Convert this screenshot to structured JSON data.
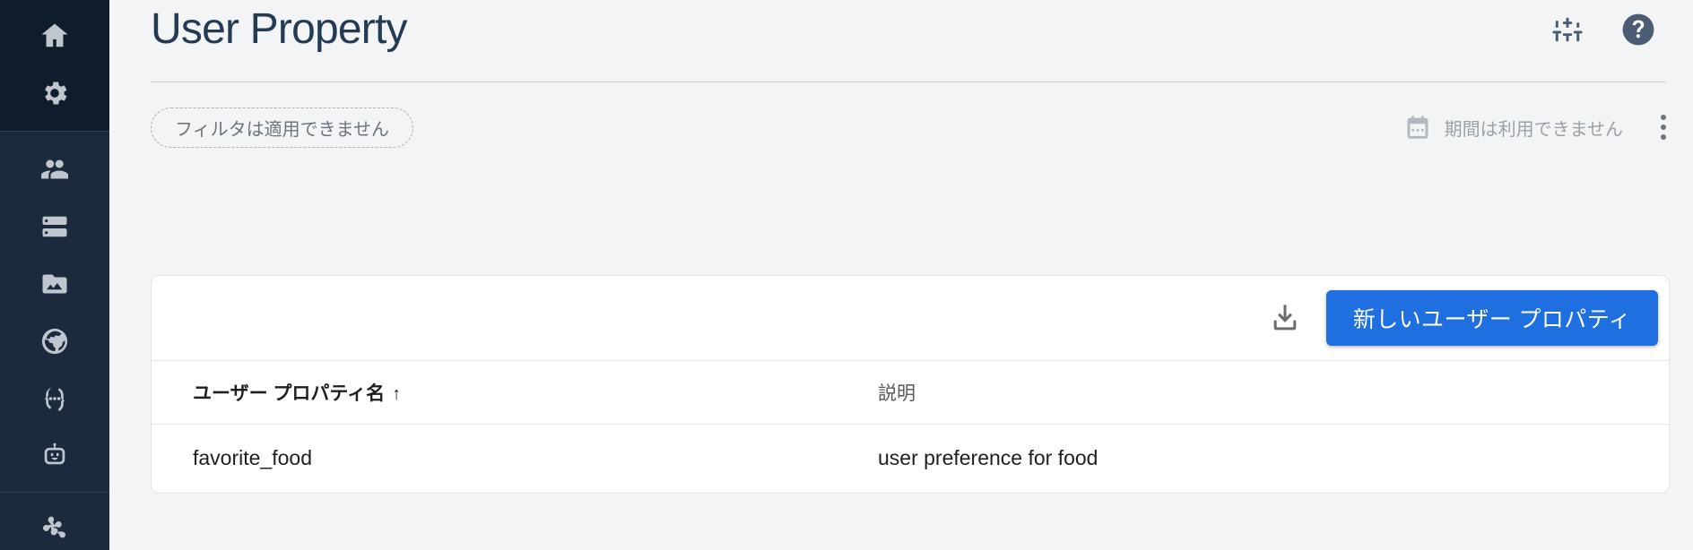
{
  "sidebar": {
    "top_items": [
      {
        "name": "home",
        "icon": "home-icon"
      },
      {
        "name": "settings",
        "icon": "gear-icon"
      }
    ],
    "mid_items": [
      {
        "name": "users",
        "icon": "people-icon"
      },
      {
        "name": "storage",
        "icon": "database-icon"
      },
      {
        "name": "media",
        "icon": "photo-folder-icon"
      },
      {
        "name": "hosting",
        "icon": "globe-icon"
      },
      {
        "name": "functions",
        "icon": "code-brackets-icon"
      },
      {
        "name": "ml",
        "icon": "robot-icon"
      }
    ],
    "bottom_items": [
      {
        "name": "extensions",
        "icon": "flower-gear-icon"
      }
    ]
  },
  "header": {
    "title": "User Property",
    "tune_icon": "tune-sliders-icon",
    "help_icon": "help-circle-icon"
  },
  "filter_bar": {
    "filter_chip_label": "フィルタは適用できません",
    "calendar_icon": "calendar-icon",
    "daterange_label": "期間は利用できません",
    "more_icon": "more-vert-icon"
  },
  "card": {
    "download_icon": "download-icon",
    "new_property_button": "新しいユーザー プロパティ",
    "table": {
      "columns": [
        {
          "label": "ユーザー プロパティ名",
          "sort": "↑"
        },
        {
          "label": "説明",
          "sort": ""
        }
      ],
      "rows": [
        {
          "name": "favorite_food",
          "description": "user preference for food"
        }
      ]
    }
  },
  "colors": {
    "sidebar_bg": "#1b2b3d",
    "sidebar_top_bg": "#0e1c2b",
    "page_bg": "#f2f4f6",
    "title": "#253b53",
    "primary": "#1f6fe0",
    "help_circle": "#4c5c74"
  }
}
